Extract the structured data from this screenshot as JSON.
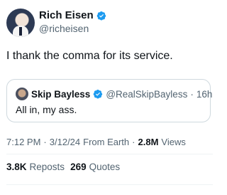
{
  "author": {
    "display_name": "Rich Eisen",
    "handle": "@richeisen"
  },
  "tweet": {
    "text": "I thank the comma for its service."
  },
  "quoted": {
    "display_name": "Skip Bayless",
    "handle": "@RealSkipBayless",
    "separator": "·",
    "time": "16h",
    "text": "All in, my ass."
  },
  "meta": {
    "time": "7:12 PM",
    "separator1": "·",
    "date": "3/12/24",
    "source": "From Earth",
    "separator2": "·",
    "views_count": "2.8M",
    "views_label": "Views"
  },
  "stats": {
    "reposts_count": "3.8K",
    "reposts_label": "Reposts",
    "quotes_count": "269",
    "quotes_label": "Quotes"
  },
  "colors": {
    "verified": "#1d9bf0",
    "secondary_text": "#536471",
    "primary_text": "#0f1419"
  },
  "icons": {
    "verified": "verified-badge-icon"
  }
}
